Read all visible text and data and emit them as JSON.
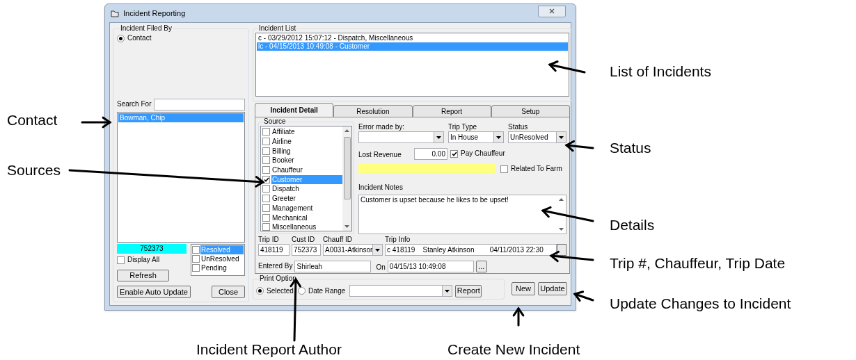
{
  "window": {
    "title": "Incident Reporting"
  },
  "filed_by": {
    "title": "Incident Filed By",
    "options": [
      {
        "label": "Contact",
        "selected": true
      }
    ]
  },
  "search": {
    "label": "Search For"
  },
  "contacts": [
    {
      "label": "Bowman, Chip",
      "selected": true
    }
  ],
  "contact_id": "752373",
  "display_all": {
    "label": "Display All",
    "checked": false
  },
  "refresh_button": "Refresh",
  "status_filter": [
    {
      "label": "Resolved",
      "checked": false,
      "selected": true
    },
    {
      "label": "UnResolved",
      "checked": false,
      "selected": false
    },
    {
      "label": "Pending",
      "checked": false,
      "selected": false
    }
  ],
  "auto_update_button": "Enable Auto Update",
  "close_button": "Close",
  "incident_list": {
    "title": "Incident List",
    "items": [
      {
        "label": "c - 03/29/2012 15:07:12 - Dispatch, Miscellaneous",
        "selected": false
      },
      {
        "label": "lc - 04/15/2013 10:49:08 - Customer",
        "selected": true
      }
    ]
  },
  "tabs": [
    {
      "label": "Incident Detail",
      "selected": true
    },
    {
      "label": "Resolution",
      "selected": false
    },
    {
      "label": "Report",
      "selected": false
    },
    {
      "label": "Setup",
      "selected": false
    }
  ],
  "source": {
    "title": "Source",
    "items": [
      {
        "label": "Affiliate",
        "checked": false,
        "selected": false
      },
      {
        "label": "Airline",
        "checked": false,
        "selected": false
      },
      {
        "label": "Billing",
        "checked": false,
        "selected": false
      },
      {
        "label": "Booker",
        "checked": false,
        "selected": false
      },
      {
        "label": "Chauffeur",
        "checked": false,
        "selected": false
      },
      {
        "label": "Customer",
        "checked": true,
        "selected": true
      },
      {
        "label": "Dispatch",
        "checked": false,
        "selected": false
      },
      {
        "label": "Greeter",
        "checked": false,
        "selected": false
      },
      {
        "label": "Management",
        "checked": false,
        "selected": false
      },
      {
        "label": "Mechanical",
        "checked": false,
        "selected": false
      },
      {
        "label": "Miscellaneous",
        "checked": false,
        "selected": false
      }
    ]
  },
  "error_made_by": {
    "label": "Error made by:"
  },
  "trip_type": {
    "label": "Trip Type",
    "value": "In House"
  },
  "status": {
    "label": "Status",
    "value": "UnResolved"
  },
  "lost_revenue": {
    "label": "Lost Revenue",
    "value": "0.00"
  },
  "pay_chauffeur": {
    "label": "Pay Chauffeur",
    "checked": true
  },
  "related_to_farm": {
    "label": "Related To Farm",
    "checked": false
  },
  "notes": {
    "label": "Incident Notes",
    "value": "Customer is upset because he likes to be upset!"
  },
  "trip_id": {
    "label": "Trip ID",
    "value": "418119"
  },
  "cust_id": {
    "label": "Cust ID",
    "value": "752373"
  },
  "chauff_id": {
    "label": "Chauff ID",
    "value": "A0031-Atkinsor"
  },
  "trip_info": {
    "label": "Trip Info",
    "value": "c 418119    Stanley Atkinson        04/11/2013 22:30"
  },
  "entered_by": {
    "label": "Entered By",
    "value": "Shirleah"
  },
  "entered_on": {
    "label": "On",
    "value": "04/15/13 10:49:08",
    "button": "..."
  },
  "print_option": {
    "title": "Print Option",
    "options": [
      {
        "label": "Selected",
        "selected": true
      },
      {
        "label": "Date Range",
        "selected": false
      }
    ],
    "report_button": "Report"
  },
  "new_button": "New",
  "update_button": "Update",
  "annotations": [
    "Contact",
    "Sources",
    "List of Incidents",
    "Status",
    "Details",
    "Trip #, Chauffeur, Trip Date",
    "Update Changes to Incident",
    "Incident Report Author",
    "Create New Incident"
  ]
}
